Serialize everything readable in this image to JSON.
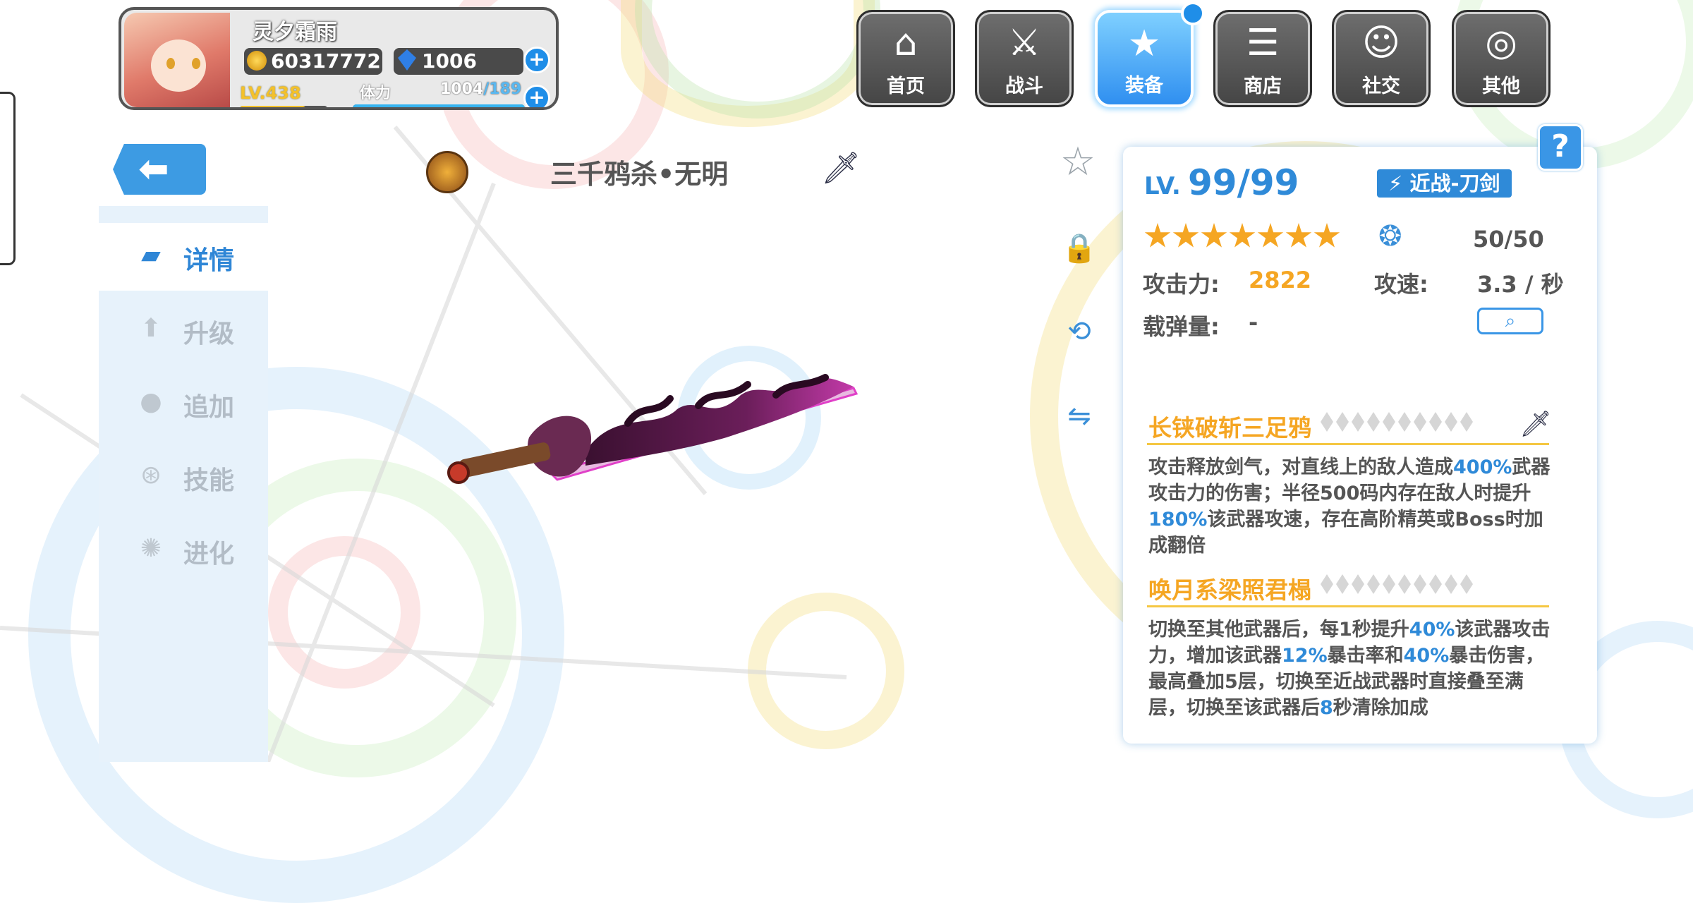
{
  "player": {
    "name": "灵夕霜雨",
    "gold": "60317772",
    "gems": "1006",
    "level": "LV.438",
    "stamina_label": "体力",
    "stamina_current": "1004",
    "stamina_max": "/189",
    "stamina_fill": 1.0,
    "level_progress": 0.75
  },
  "nav": [
    {
      "label": "首页",
      "icon": "home-icon"
    },
    {
      "label": "战斗",
      "icon": "battle-icon"
    },
    {
      "label": "装备",
      "icon": "equipment-icon",
      "active": true
    },
    {
      "label": "商店",
      "icon": "shop-icon"
    },
    {
      "label": "社交",
      "icon": "social-icon"
    },
    {
      "label": "其他",
      "icon": "other-icon"
    }
  ],
  "sidebar": [
    {
      "label": "详情",
      "icon": "gun-icon",
      "active": true
    },
    {
      "label": "升级",
      "icon": "upgrade-arrow-icon"
    },
    {
      "label": "追加",
      "icon": "append-icon"
    },
    {
      "label": "技能",
      "icon": "skill-icon"
    },
    {
      "label": "进化",
      "icon": "evolve-icon"
    }
  ],
  "weapon": {
    "title": "三千鸦杀•无明"
  },
  "info": {
    "lv_prefix": "LV.",
    "lv_value": "99/99",
    "class_tag": "近战-刀剑",
    "stars": 7,
    "ammo_value": "50/50",
    "attack_label": "攻击力:",
    "attack_value": "2822",
    "speed_label": "攻速:",
    "speed_value": "3.3 / 秒",
    "clip_label": "载弹量:",
    "clip_value": "-",
    "help_label": "?"
  },
  "skills": [
    {
      "name": "长铗破斩三足鸦",
      "desc": [
        {
          "t": "攻击释放剑气，对直线上的敌人造成"
        },
        {
          "t": "400%",
          "hl": true
        },
        {
          "t": "武器攻击力的伤害；半径500码内存在敌人时提升"
        },
        {
          "t": "180%",
          "hl": true
        },
        {
          "t": "该武器攻速，存在高阶精英或Boss时加成翻倍"
        }
      ]
    },
    {
      "name": "唤月系梁照君榻",
      "desc": [
        {
          "t": "切换至其他武器后，每1秒提升"
        },
        {
          "t": "40%",
          "hl": true
        },
        {
          "t": "该武器攻击力，增加该武器"
        },
        {
          "t": "12%",
          "hl": true
        },
        {
          "t": "暴击率和"
        },
        {
          "t": "40%",
          "hl": true
        },
        {
          "t": "暴击伤害，最高叠加5层，切换至近战武器时直接叠至满层，切换至该武器后"
        },
        {
          "t": "8",
          "hl": true
        },
        {
          "t": "秒清除加成"
        }
      ]
    }
  ],
  "colors": {
    "accent": "#2f8ad8",
    "gold": "#f5a623",
    "sidebar_bg": "#e7f2fb"
  }
}
